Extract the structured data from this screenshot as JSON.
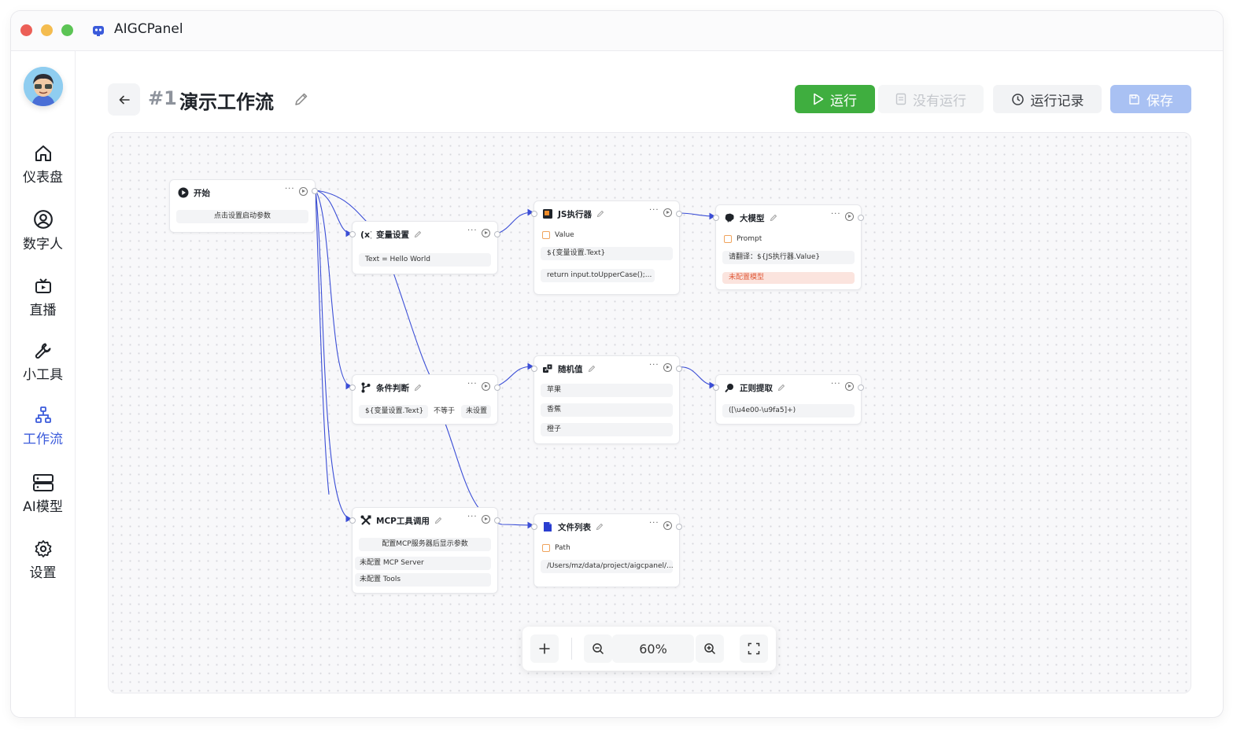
{
  "app": {
    "title": "AIGCPanel"
  },
  "sidebar": {
    "items": [
      {
        "label": "仪表盘",
        "icon": "home-icon"
      },
      {
        "label": "数字人",
        "icon": "user-circle-icon"
      },
      {
        "label": "直播",
        "icon": "tv-icon"
      },
      {
        "label": "小工具",
        "icon": "wrench-icon"
      },
      {
        "label": "工作流",
        "icon": "workflow-icon",
        "active": true
      },
      {
        "label": "AI模型",
        "icon": "server-icon"
      },
      {
        "label": "设置",
        "icon": "gear-icon"
      }
    ]
  },
  "header": {
    "number": "#1",
    "title": "演示工作流",
    "run_label": "运行",
    "no_run_label": "没有运行",
    "history_label": "运行记录",
    "save_label": "保存"
  },
  "colors": {
    "run": "#3fae3f",
    "save": "#a9c1f3",
    "edge": "#3b4ed6",
    "active_nav": "#3b5bdb",
    "warning": "#e05a3a"
  },
  "nodes": {
    "start": {
      "title": "开始",
      "field": "点击设置启动参数"
    },
    "var": {
      "title": "变量设置",
      "field": "Text = Hello World"
    },
    "js": {
      "title": "JS执行器",
      "label": "Value",
      "field1": "${变量设置.Text}",
      "field2": "return input.toUpperCase();..."
    },
    "llm": {
      "title": "大模型",
      "label": "Prompt",
      "field1": "请翻译：${JS执行器.Value}",
      "warning": "未配置模型"
    },
    "cond": {
      "title": "条件判断",
      "left": "${变量设置.Text}",
      "op": "不等于",
      "right": "未设置"
    },
    "random": {
      "title": "随机值",
      "items": [
        "苹果",
        "香蕉",
        "橙子"
      ]
    },
    "regex": {
      "title": "正则提取",
      "field": "([\\u4e00-\\u9fa5]+)"
    },
    "mcp": {
      "title": "MCP工具调用",
      "field1": "配置MCP服务器后显示参数",
      "field2": "未配置 MCP Server",
      "field3": "未配置 Tools"
    },
    "files": {
      "title": "文件列表",
      "label": "Path",
      "field": "/Users/mz/data/project/aigcpanel/..."
    }
  },
  "zoom": {
    "level": "60%"
  }
}
